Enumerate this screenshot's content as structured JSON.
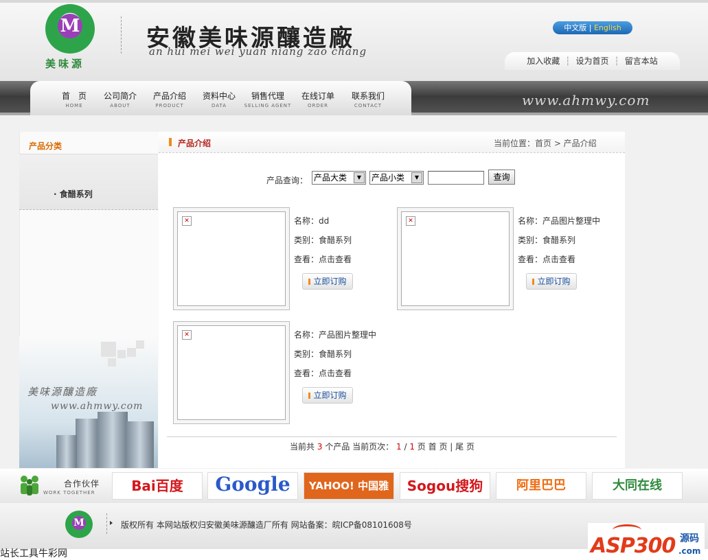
{
  "header": {
    "logo_text": "美味源",
    "title": "安徽美味源釀造廠",
    "subtitle": "an hui mei wei yuan niang zao chang",
    "lang_cn": "中文版",
    "lang_sep": "|",
    "lang_en": "English",
    "quick_links": [
      "加入收藏",
      "设为首页",
      "留言本站"
    ]
  },
  "nav": {
    "items": [
      {
        "cn": "首　页",
        "en": "HOME"
      },
      {
        "cn": "公司简介",
        "en": "ABOUT"
      },
      {
        "cn": "产品介绍",
        "en": "PRODUCT"
      },
      {
        "cn": "资料中心",
        "en": "DATA"
      },
      {
        "cn": "销售代理",
        "en": "SELLING AGENT"
      },
      {
        "cn": "在线订单",
        "en": "ORDER"
      },
      {
        "cn": "联系我们",
        "en": "CONTACT"
      }
    ],
    "site_url": "www.ahmwy.com"
  },
  "sidebar": {
    "title": "产品分类",
    "items": [
      "· 食醋系列"
    ],
    "brand": "美味源釀造廠",
    "url": "www.ahmwy.com"
  },
  "main": {
    "title": "产品介绍",
    "breadcrumb": "当前位置：首页 > 产品介绍",
    "search": {
      "label": "产品查询：",
      "category": "产品大类",
      "subcategory": "产品小类",
      "keyword": "",
      "button": "查询"
    },
    "products": [
      {
        "name": "名称：dd",
        "type": "类别：食醋系列",
        "view": "查看：点击查看",
        "buy": "立即订购"
      },
      {
        "name": "名称：产品图片整理中",
        "type": "类别：食醋系列",
        "view": "查看：点击查看",
        "buy": "立即订购"
      },
      {
        "name": "名称：产品图片整理中",
        "type": "类别：食醋系列",
        "view": "查看：点击查看",
        "buy": "立即订购"
      }
    ],
    "pager": {
      "prefix": "当前共",
      "total": "3",
      "total_suffix": "个产品 当前页次：",
      "current": "1",
      "slash": "/",
      "pages": "1",
      "pages_suffix": "页",
      "first": "首 页",
      "sep": "|",
      "last": "尾 页"
    }
  },
  "partners": {
    "title_cn": "合作伙伴",
    "title_en": "WORK TOGETHER",
    "logos": [
      "Bai百度",
      "Google",
      "YAHOO! 中国雅虎",
      "Sogou搜狗",
      "阿里巴巴",
      "大同在线"
    ]
  },
  "footer": {
    "copyright": "版权所有 本网站版权归安徽美味源釀造厂所有 网站备案：皖ICP备08101608号",
    "watermark": "站长工具牛彩网",
    "badge_main": "ASP300",
    "badge_yuan": "源码",
    "badge_com": ".com"
  },
  "colors": {
    "accent_orange": "#f08a1c",
    "title_red": "#b3261e",
    "link_blue": "#1a4fa0",
    "logo_green": "#2ea44a",
    "logo_purple": "#9b3fb8"
  }
}
